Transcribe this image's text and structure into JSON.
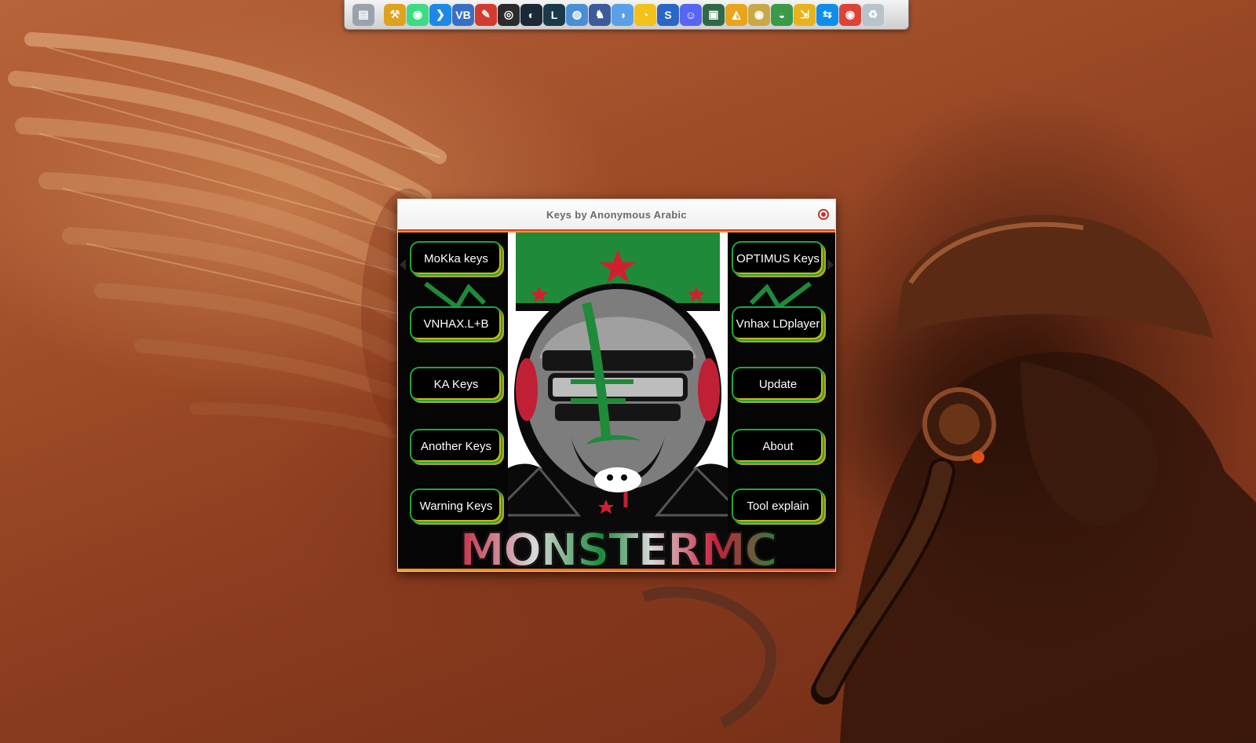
{
  "dock": {
    "icons": [
      {
        "name": "finder-icon",
        "color": "#9aa3ad",
        "glyph": "▤"
      },
      {
        "name": "tools-icon",
        "color": "#e0a020",
        "glyph": "⚒"
      },
      {
        "name": "android-studio-icon",
        "color": "#3ddc84",
        "glyph": "◉"
      },
      {
        "name": "vscode-icon",
        "color": "#1e88e5",
        "glyph": "❯"
      },
      {
        "name": "virtualbox-icon",
        "color": "#3a6fc4",
        "glyph": "VB"
      },
      {
        "name": "pdf-editor-icon",
        "color": "#d33b30",
        "glyph": "✎"
      },
      {
        "name": "obs-icon",
        "color": "#2b2b2b",
        "glyph": "◎"
      },
      {
        "name": "steam-icon",
        "color": "#1b2838",
        "glyph": "◐"
      },
      {
        "name": "league-icon",
        "color": "#1a3a4a",
        "glyph": "L"
      },
      {
        "name": "network-globe-icon",
        "color": "#4a8fd4",
        "glyph": "◍"
      },
      {
        "name": "game-launcher-icon",
        "color": "#3b5b9a",
        "glyph": "♞"
      },
      {
        "name": "browser-globe-icon",
        "color": "#5aa0e6",
        "glyph": "◑"
      },
      {
        "name": "emulator-icon",
        "color": "#f2c21b",
        "glyph": "◔"
      },
      {
        "name": "shark-icon",
        "color": "#2a65c7",
        "glyph": "S"
      },
      {
        "name": "discord-icon",
        "color": "#5865f2",
        "glyph": "☺"
      },
      {
        "name": "monitor-icon",
        "color": "#2e6a45",
        "glyph": "▣"
      },
      {
        "name": "pizza-icon",
        "color": "#e8a41c",
        "glyph": "◭"
      },
      {
        "name": "disc-icon",
        "color": "#c9a84a",
        "glyph": "◉"
      },
      {
        "name": "earth-icon",
        "color": "#3a9a4a",
        "glyph": "◒"
      },
      {
        "name": "folder-share-icon",
        "color": "#e8b21c",
        "glyph": "⇲"
      },
      {
        "name": "teamviewer-icon",
        "color": "#0e8ee9",
        "glyph": "⇆"
      },
      {
        "name": "chrome-icon",
        "color": "#db4437",
        "glyph": "◉"
      },
      {
        "name": "trash-icon",
        "color": "#b9c3cc",
        "glyph": "♻"
      }
    ]
  },
  "window": {
    "title": "Keys by Anonymous Arabic",
    "brand_text": "MONSTERMC",
    "left_buttons": [
      "MoKka keys",
      "VNHAX.L+B",
      "KA Keys",
      "Another Keys",
      "Warning Keys"
    ],
    "right_buttons": [
      "OPTIMUS Keys",
      "Vnhax LDplayer",
      "Update",
      "About",
      "Tool explain"
    ]
  },
  "colors": {
    "button_border_green": "#1ea83a",
    "button_shadow_yellow": "#c8b51a",
    "accent_red": "#e8401c",
    "accent_orange": "#f39a1f"
  }
}
